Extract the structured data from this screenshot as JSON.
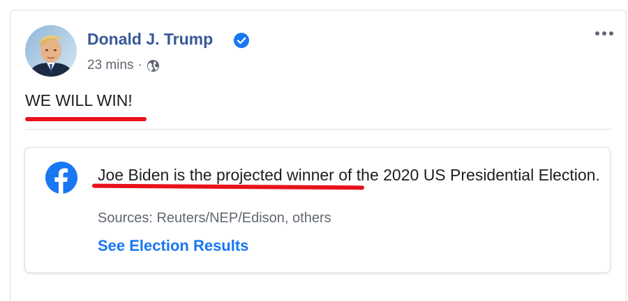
{
  "post": {
    "author_name": "Donald J. Trump",
    "verified": true,
    "timestamp": "23 mins",
    "separator": "·",
    "privacy_icon": "globe-icon",
    "more_icon": "more-options-icon",
    "text": "WE WILL WIN!"
  },
  "info_label": {
    "icon": "facebook-logo-icon",
    "message": "Joe Biden is the projected winner of the 2020 US Presidential Election.",
    "sources": "Sources: Reuters/NEP/Edison, others",
    "link_label": "See Election Results"
  },
  "colors": {
    "author_blue": "#385898",
    "link_blue": "#1877f2",
    "facebook_blue": "#1877f2",
    "verified_blue": "#1877f2",
    "annotation_red": "#e8121c",
    "secondary_text": "#606770"
  }
}
